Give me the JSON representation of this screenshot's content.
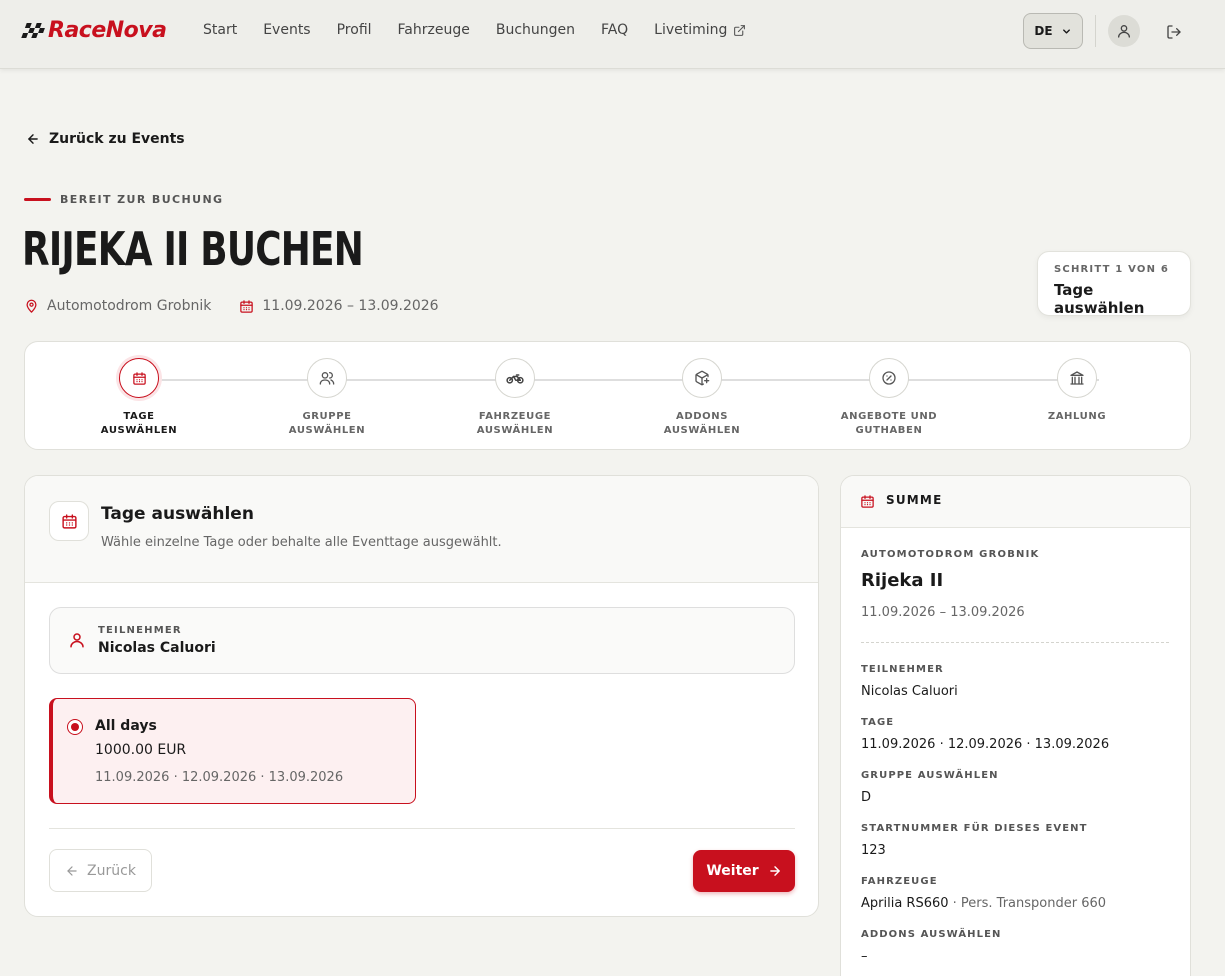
{
  "brand": {
    "name": "RaceNova",
    "color": "#c8101e"
  },
  "nav": {
    "links": [
      "Start",
      "Events",
      "Profil",
      "Fahrzeuge",
      "Buchungen",
      "FAQ",
      "Livetiming"
    ],
    "language": "DE"
  },
  "back_link": "Zurück zu Events",
  "eyebrow": "BEREIT ZUR BUCHUNG",
  "title": "RIJEKA II BUCHEN",
  "venue": "Automotodrom Grobnik",
  "date_range": "11.09.2026 – 13.09.2026",
  "step_badge": {
    "label": "SCHRITT 1 VON 6",
    "value": "Tage auswählen"
  },
  "steps": [
    {
      "label": "TAGE\nAUSWÄHLEN",
      "icon": "calendar-icon",
      "active": true
    },
    {
      "label": "GRUPPE\nAUSWÄHLEN",
      "icon": "users-icon",
      "active": false
    },
    {
      "label": "FAHRZEUGE\nAUSWÄHLEN",
      "icon": "motorcycle-icon",
      "active": false
    },
    {
      "label": "ADDONS\nAUSWÄHLEN",
      "icon": "package-plus-icon",
      "active": false
    },
    {
      "label": "ANGEBOTE UND\nGUTHABEN",
      "icon": "badge-percent-icon",
      "active": false
    },
    {
      "label": "ZAHLUNG",
      "icon": "bank-icon",
      "active": false
    }
  ],
  "card": {
    "title": "Tage auswählen",
    "subtitle": "Wähle einzelne Tage oder behalte alle Eventtage ausgewählt.",
    "participant_label": "TEILNEHMER",
    "participant_name": "Nicolas Caluori",
    "option": {
      "title": "All days",
      "price": "1000.00 EUR",
      "dates": "11.09.2026 · 12.09.2026 · 13.09.2026",
      "selected": true
    },
    "back_button": "Zurück",
    "next_button": "Weiter"
  },
  "summary": {
    "heading": "SUMME",
    "venue": "AUTOMOTODROM GROBNIK",
    "event": "Rijeka II",
    "dates": "11.09.2026 – 13.09.2026",
    "items": [
      {
        "label": "TEILNEHMER",
        "value": "Nicolas Caluori",
        "muted": ""
      },
      {
        "label": "TAGE",
        "value": "11.09.2026 · 12.09.2026 · 13.09.2026",
        "muted": ""
      },
      {
        "label": "GRUPPE AUSWÄHLEN",
        "value": "D",
        "muted": ""
      },
      {
        "label": "STARTNUMMER FÜR DIESES EVENT",
        "value": "123",
        "muted": ""
      },
      {
        "label": "FAHRZEUGE",
        "value": "Aprilia RS660",
        "muted": " · Pers. Transponder 660"
      },
      {
        "label": "ADDONS AUSWÄHLEN",
        "value": "–",
        "muted": ""
      }
    ]
  }
}
